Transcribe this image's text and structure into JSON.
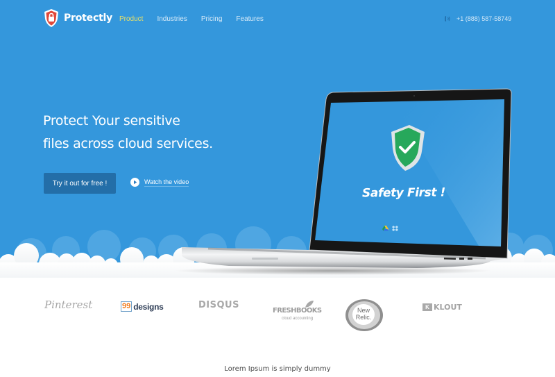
{
  "brand": {
    "name": "Protectly",
    "logo_icon": "shield-lock-icon"
  },
  "nav": {
    "items": [
      {
        "label": "Product",
        "active": true
      },
      {
        "label": "Industries",
        "active": false
      },
      {
        "label": "Pricing",
        "active": false
      },
      {
        "label": "Features",
        "active": false
      }
    ],
    "phone_icon": "phone-icon",
    "phone": "+1 (888) 587-58749"
  },
  "hero": {
    "headline_line1": "Protect Your sensitive",
    "headline_line2": "files across cloud services.",
    "cta_label": "Try it out for free !",
    "video_label": "Watch the video",
    "video_icon": "play-icon"
  },
  "laptop_screen": {
    "shield_icon": "shield-check-icon",
    "tagline": "Safety First !",
    "service_icons": [
      "google-drive-icon",
      "dropbox-icon"
    ]
  },
  "client_logos": [
    {
      "name": "Pinterest"
    },
    {
      "prefix": "99",
      "name": "designs"
    },
    {
      "name": "DISQUS"
    },
    {
      "name": "FRESHBOOKS",
      "sub": "cloud accounting"
    },
    {
      "name": "New Relic."
    },
    {
      "badge": "K",
      "name": "KLOUT"
    }
  ],
  "section_teaser": "Lorem Ipsum is simply dummy",
  "colors": {
    "hero_bg": "#3497dc",
    "nav_active": "#e5e06a",
    "cta_bg": "#236ea8",
    "logo_shield": "#e0483a",
    "screen_shield": "#27a85b"
  }
}
